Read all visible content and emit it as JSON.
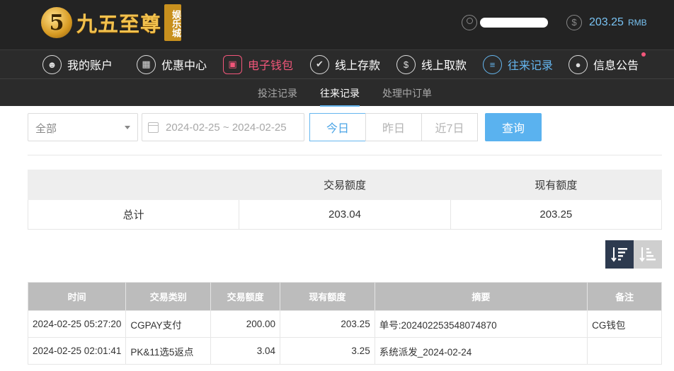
{
  "header": {
    "logo_mark": "5",
    "logo_text": "九五至尊",
    "logo_sub": "娱乐城",
    "balance_amount": "203.25",
    "balance_unit": "RMB"
  },
  "nav": {
    "items": [
      {
        "label": "我的账户",
        "icon": "user-icon"
      },
      {
        "label": "优惠中心",
        "icon": "gift-icon"
      },
      {
        "label": "电子钱包",
        "icon": "wallet-icon"
      },
      {
        "label": "线上存款",
        "icon": "deposit-icon"
      },
      {
        "label": "线上取款",
        "icon": "withdraw-icon"
      },
      {
        "label": "往来记录",
        "icon": "records-icon"
      },
      {
        "label": "信息公告",
        "icon": "bell-icon"
      }
    ]
  },
  "subnav": {
    "tabs": [
      "投注记录",
      "往来记录",
      "处理中订单"
    ],
    "active": "往来记录"
  },
  "filters": {
    "type_value": "全部",
    "date_range": "2024-02-25 ~ 2024-02-25",
    "quick": [
      "今日",
      "昨日",
      "近7日"
    ],
    "query_label": "查询"
  },
  "summary": {
    "headers": [
      "",
      "交易额度",
      "现有额度"
    ],
    "row": [
      "总计",
      "203.04",
      "203.25"
    ]
  },
  "records": {
    "headers": [
      "时间",
      "交易类别",
      "交易额度",
      "现有额度",
      "摘要",
      "备注"
    ],
    "rows": [
      [
        "2024-02-25 05:27:20",
        "CGPAY支付",
        "200.00",
        "203.25",
        "单号:202402253548074870",
        "CG钱包"
      ],
      [
        "2024-02-25 02:01:41",
        "PK&11选5返点",
        "3.04",
        "3.25",
        "系统派发_2024-02-24",
        ""
      ]
    ]
  },
  "colors": {
    "accent": "#65b6ef",
    "highlight_red": "#f2567a",
    "header_bg": "#232323"
  }
}
